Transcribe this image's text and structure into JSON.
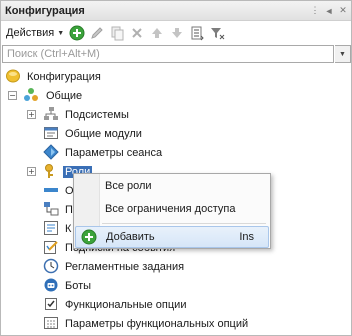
{
  "window": {
    "title": "Конфигурация"
  },
  "toolbar": {
    "actions_label": "Действия"
  },
  "search": {
    "placeholder": "Поиск (Ctrl+Alt+M)"
  },
  "tree": [
    {
      "label": "Конфигурация",
      "icon": "configuration-icon"
    },
    {
      "label": "Общие",
      "icon": "common-icon"
    },
    {
      "label": "Подсистемы",
      "icon": "subsystems-icon"
    },
    {
      "label": "Общие модули",
      "icon": "common-modules-icon"
    },
    {
      "label": "Параметры сеанса",
      "icon": "session-params-icon"
    },
    {
      "label": "Роли",
      "icon": "roles-icon"
    },
    {
      "label": "Подписки на события",
      "icon": "event-subscriptions-icon"
    },
    {
      "label": "Регламентные задания",
      "icon": "scheduled-jobs-icon"
    },
    {
      "label": "Боты",
      "icon": "bots-icon"
    },
    {
      "label": "Функциональные опции",
      "icon": "functional-options-icon"
    },
    {
      "label": "Параметры функциональных опций",
      "icon": "functional-option-params-icon"
    }
  ],
  "context_menu": {
    "items": [
      {
        "label": "Все роли",
        "shortcut": ""
      },
      {
        "label": "Все ограничения доступа",
        "shortcut": ""
      },
      {
        "label": "Добавить",
        "shortcut": "Ins"
      }
    ]
  },
  "colors": {
    "selection": "#3a6fb6",
    "add_green": "#3ba33b"
  }
}
